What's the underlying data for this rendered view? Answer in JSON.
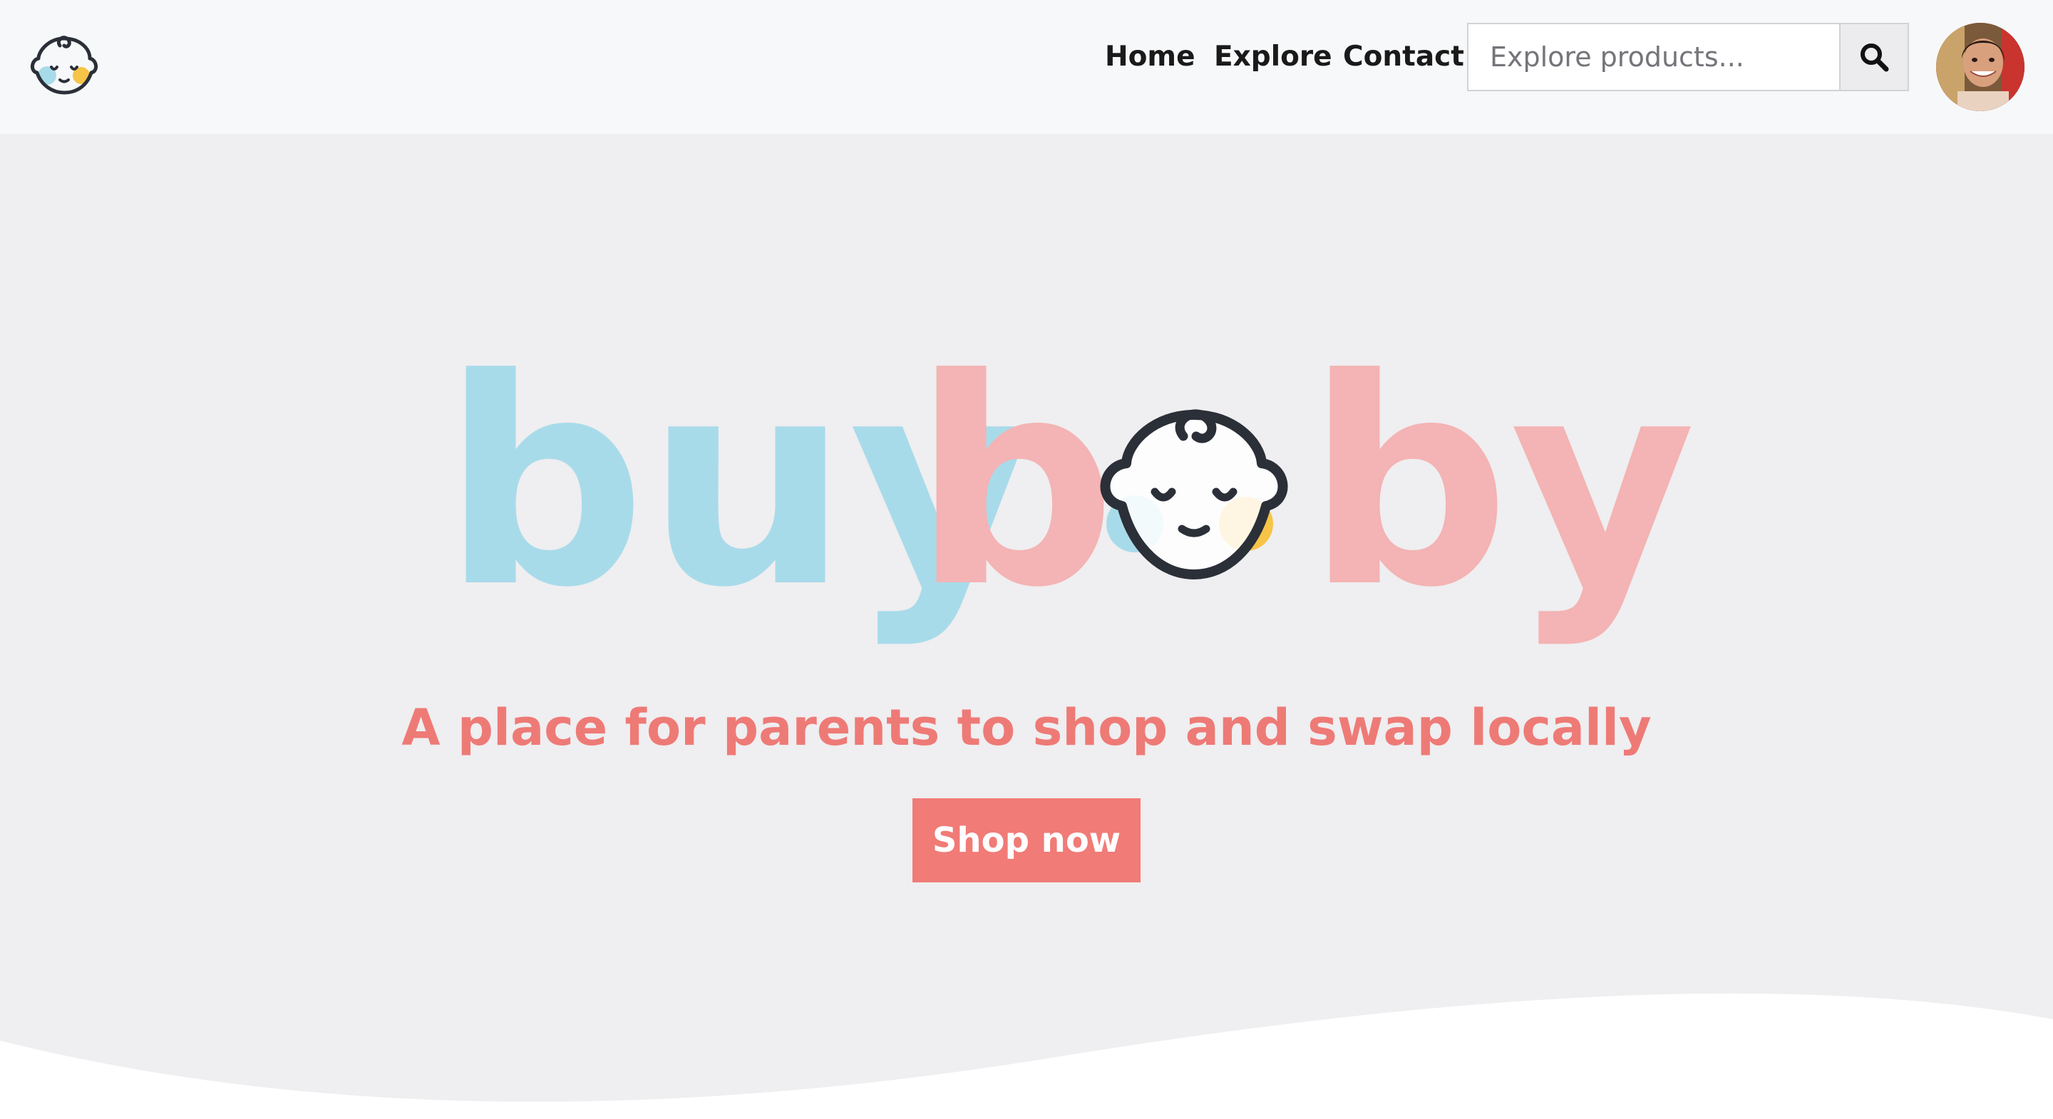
{
  "brand": {
    "logo_icon": "baby-face-icon",
    "wordmark_part1": "buy",
    "wordmark_part2": "b",
    "wordmark_part3": "by",
    "colors": {
      "blue": "#a8dbea",
      "pink": "#f4b3b4",
      "coral": "#f07b77",
      "yellow": "#f6c447",
      "outline": "#2b2f38"
    }
  },
  "nav": {
    "links": [
      {
        "label": "Home"
      },
      {
        "label": "Explore"
      },
      {
        "label": "Contact"
      }
    ],
    "search": {
      "placeholder": "Explore products...",
      "icon": "search-icon"
    },
    "avatar_icon": "user-avatar"
  },
  "hero": {
    "tagline": "A place for parents to shop and swap locally",
    "cta_label": "Shop now"
  }
}
